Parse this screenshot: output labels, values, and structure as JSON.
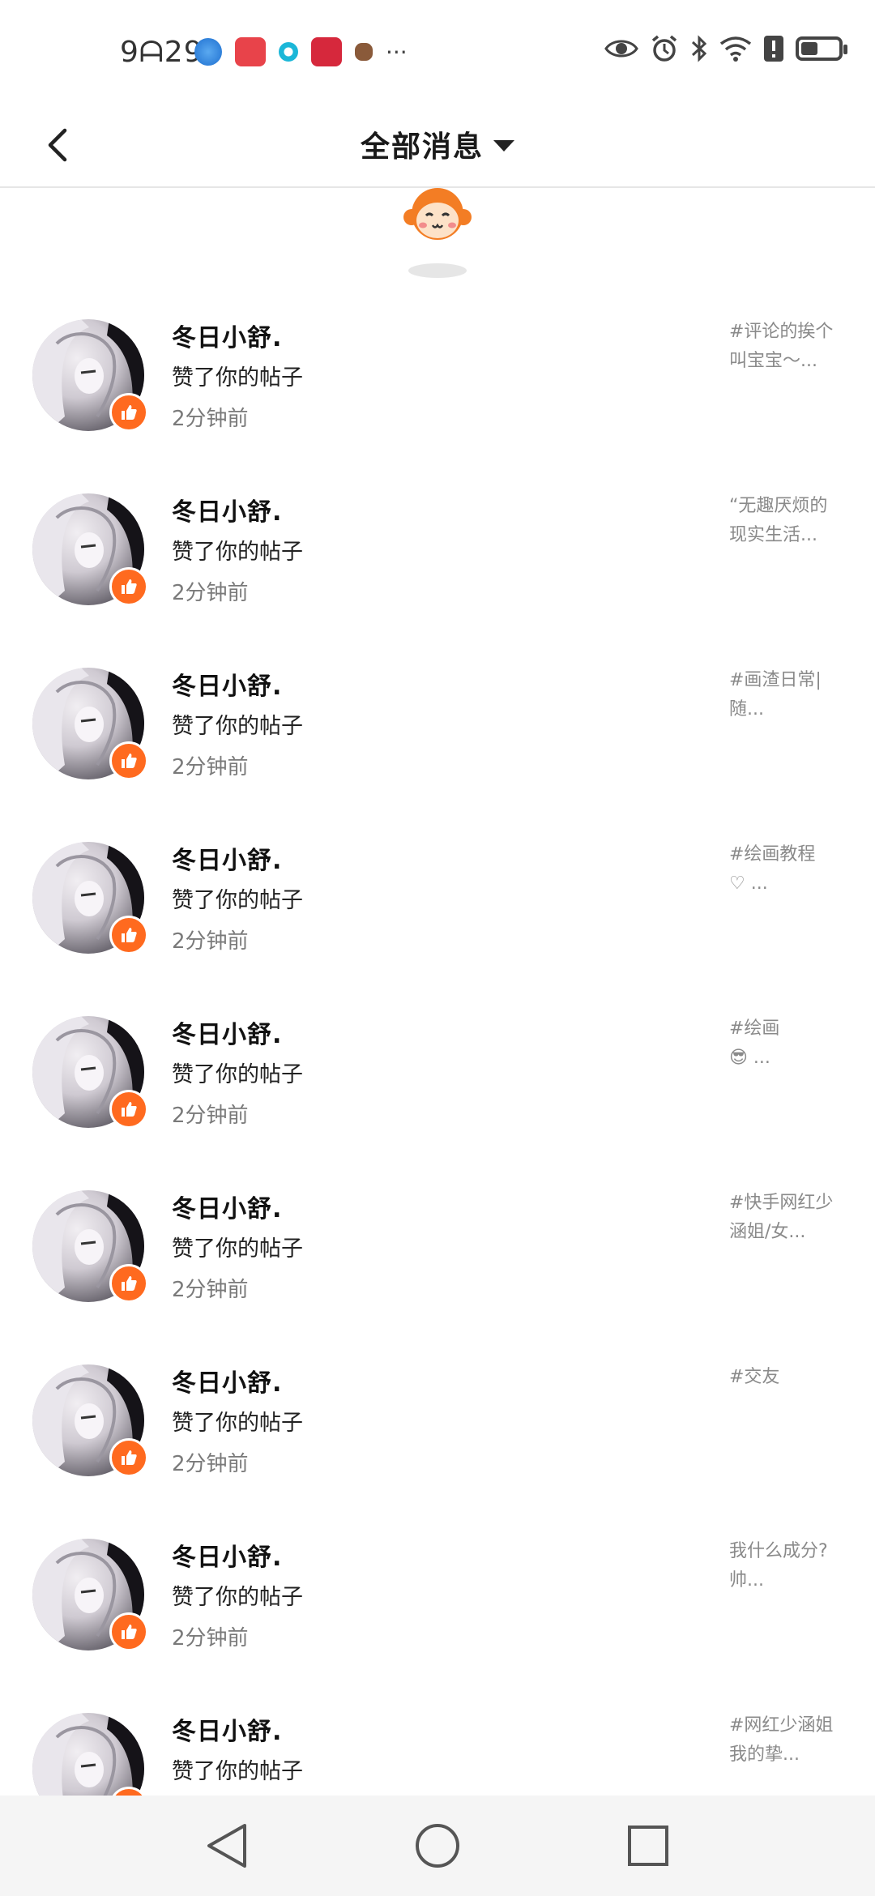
{
  "status_bar": {
    "time": "9ᗩ29",
    "more": "···",
    "notification_icons": [
      "browser-icon",
      "huawei-appgallery-icon",
      "app-icon",
      "reader-icon",
      "pet-icon"
    ],
    "system_icons": [
      "eye-icon",
      "alarm-icon",
      "bluetooth-icon",
      "wifi-icon",
      "alert-icon",
      "battery-icon"
    ],
    "battery_level": 0.45
  },
  "header": {
    "title": "全部消息"
  },
  "notifications": [
    {
      "user": "冬日小舒.",
      "action": "赞了你的帖子",
      "time": "2分钟前",
      "snippet_line1": "#评论的挨个",
      "snippet_line2": "叫宝宝～..."
    },
    {
      "user": "冬日小舒.",
      "action": "赞了你的帖子",
      "time": "2分钟前",
      "snippet_line1": "“无趣厌烦的",
      "snippet_line2": "现实生活..."
    },
    {
      "user": "冬日小舒.",
      "action": "赞了你的帖子",
      "time": "2分钟前",
      "snippet_line1": "#画渣日常|",
      "snippet_line2": "随..."
    },
    {
      "user": "冬日小舒.",
      "action": "赞了你的帖子",
      "time": "2分钟前",
      "snippet_line1": "#绘画教程",
      "snippet_line2": "♡      ..."
    },
    {
      "user": "冬日小舒.",
      "action": "赞了你的帖子",
      "time": "2分钟前",
      "snippet_line1": "#绘画",
      "snippet_line2": "😎        ..."
    },
    {
      "user": "冬日小舒.",
      "action": "赞了你的帖子",
      "time": "2分钟前",
      "snippet_line1": "#快手网红少",
      "snippet_line2": "涵姐/女..."
    },
    {
      "user": "冬日小舒.",
      "action": "赞了你的帖子",
      "time": "2分钟前",
      "snippet_line1": "#交友",
      "snippet_line2": ""
    },
    {
      "user": "冬日小舒.",
      "action": "赞了你的帖子",
      "time": "2分钟前",
      "snippet_line1": "我什么成分?",
      "snippet_line2": "帅..."
    },
    {
      "user": "冬日小舒.",
      "action": "赞了你的帖子",
      "time": "",
      "snippet_line1": "#网红少涵姐",
      "snippet_line2": "我的挚..."
    }
  ],
  "colors": {
    "accent": "#ff6a1f",
    "navbar_bg": "#f5f5f5",
    "divider": "#e6e6e6"
  }
}
